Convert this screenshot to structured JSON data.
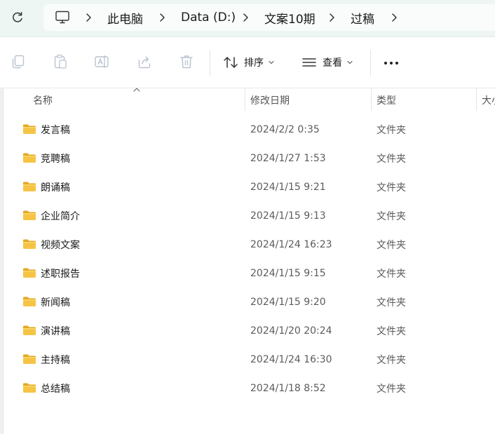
{
  "address_bar": {
    "breadcrumbs": [
      {
        "label": "此电脑"
      },
      {
        "label": "Data (D:)"
      },
      {
        "label": "文案10期"
      },
      {
        "label": "过稿"
      }
    ]
  },
  "toolbar": {
    "sort_label": "排序",
    "view_label": "查看"
  },
  "columns": {
    "name": "名称",
    "modified": "修改日期",
    "type": "类型",
    "size": "大小"
  },
  "files": [
    {
      "name": "发言稿",
      "modified": "2024/2/2 0:35",
      "type": "文件夹"
    },
    {
      "name": "竞聘稿",
      "modified": "2024/1/27 1:53",
      "type": "文件夹"
    },
    {
      "name": "朗诵稿",
      "modified": "2024/1/15 9:21",
      "type": "文件夹"
    },
    {
      "name": "企业简介",
      "modified": "2024/1/15 9:13",
      "type": "文件夹"
    },
    {
      "name": "视频文案",
      "modified": "2024/1/24 16:23",
      "type": "文件夹"
    },
    {
      "name": "述职报告",
      "modified": "2024/1/15 9:15",
      "type": "文件夹"
    },
    {
      "name": "新闻稿",
      "modified": "2024/1/15 9:20",
      "type": "文件夹"
    },
    {
      "name": "演讲稿",
      "modified": "2024/1/20 20:24",
      "type": "文件夹"
    },
    {
      "name": "主持稿",
      "modified": "2024/1/24 16:30",
      "type": "文件夹"
    },
    {
      "name": "总结稿",
      "modified": "2024/1/18 8:52",
      "type": "文件夹"
    }
  ],
  "colors": {
    "address_bar_bg": "#eef6f4",
    "folder_yellow": "#f6c445"
  }
}
